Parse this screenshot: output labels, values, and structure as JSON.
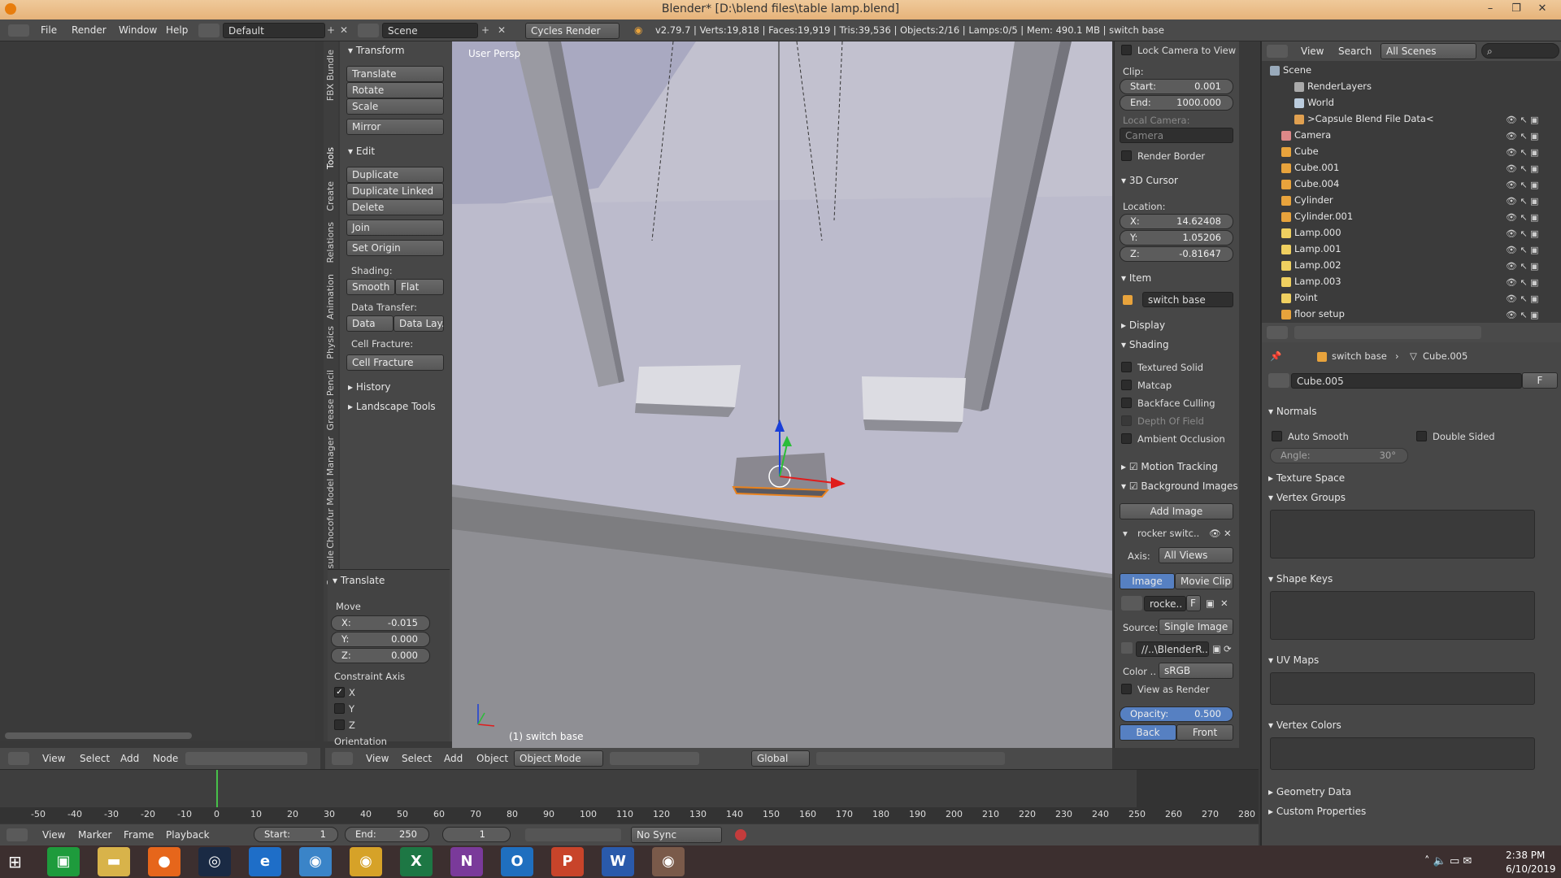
{
  "window": {
    "title": "Blender* [D:\\blend files\\table lamp.blend]",
    "min": "–",
    "max": "❐",
    "close": "✕"
  },
  "menu": {
    "items": [
      "File",
      "Render",
      "Window",
      "Help"
    ],
    "layout": "Default",
    "scene": "Scene",
    "engine": "Cycles Render",
    "stats": "v2.79.7 | Verts:19,818 | Faces:19,919 | Tris:39,536 | Objects:2/16 | Lamps:0/5 | Mem: 490.1 MB | switch base"
  },
  "toolshelf": {
    "tabs": [
      "FBX Bundle",
      "Tools",
      "Create",
      "Relations",
      "Animation",
      "Physics",
      "Grease Pencil",
      "Chocofur Model Manager",
      "Capsule"
    ],
    "transform": {
      "title": "Transform",
      "buttons": [
        "Translate",
        "Rotate",
        "Scale",
        "Mirror"
      ]
    },
    "edit": {
      "title": "Edit",
      "buttons": [
        "Duplicate",
        "Duplicate Linked",
        "Delete",
        "Join"
      ],
      "set_origin": "Set Origin",
      "shading_label": "Shading:",
      "smooth": "Smooth",
      "flat": "Flat",
      "data_transfer_label": "Data Transfer:",
      "data": "Data",
      "data_lay": "Data Lay..",
      "cell_fracture_label": "Cell Fracture:",
      "cell_fracture": "Cell Fracture"
    },
    "history": "History",
    "landscape": "Landscape Tools",
    "operator": {
      "title": "Translate",
      "move": "Move",
      "x": "X:",
      "xv": "-0.015",
      "y": "Y:",
      "yv": "0.000",
      "z": "Z:",
      "zv": "0.000",
      "constraint": "Constraint Axis",
      "cx": "X",
      "cy": "Y",
      "cz": "Z",
      "orientation": "Orientation"
    }
  },
  "viewport": {
    "label": "User Persp",
    "object_label": "(1) switch base",
    "menu": [
      "View",
      "Select",
      "Add",
      "Object"
    ],
    "mode": "Object Mode",
    "orientation": "Global"
  },
  "nodeeditor": {
    "menu": [
      "View",
      "Select",
      "Add",
      "Node"
    ]
  },
  "props": {
    "lock_camera": "Lock Camera to View",
    "clip": "Clip:",
    "start_k": "Start:",
    "start_v": "0.001",
    "end_k": "End:",
    "end_v": "1000.000",
    "local_camera": "Local Camera:",
    "camera": "Camera",
    "render_border": "Render Border",
    "cursor_title": "3D Cursor",
    "location": "Location:",
    "cx": "X:",
    "cxv": "14.62408",
    "cy": "Y:",
    "cyv": "1.05206",
    "cz": "Z:",
    "czv": "-0.81647",
    "item_title": "Item",
    "item_name": "switch base",
    "display": "Display",
    "shading": "Shading",
    "textured_solid": "Textured Solid",
    "matcap": "Matcap",
    "backface": "Backface Culling",
    "dof": "Depth Of Field",
    "ao": "Ambient Occlusion",
    "motion_tracking": "Motion Tracking",
    "bg_images": "Background Images",
    "add_image": "Add Image",
    "bg_item": "rocker switc..",
    "axis_k": "Axis:",
    "axis_v": "All Views",
    "image": "Image",
    "movie_clip": "Movie Clip",
    "img_name": "rocke..",
    "img_f": "F",
    "source_k": "Source:",
    "source_v": "Single Image",
    "path": "//..\\BlenderR..",
    "color_k": "Color ..",
    "color_v": "sRGB",
    "view_as_render": "View as Render",
    "opacity_k": "Opacity:",
    "opacity_v": "0.500",
    "back": "Back",
    "front": "Front"
  },
  "outliner": {
    "menu": [
      "View",
      "Search"
    ],
    "filter": "All Scenes",
    "rows": [
      {
        "name": "Scene"
      },
      {
        "name": "RenderLayers"
      },
      {
        "name": "World"
      },
      {
        "name": ">Capsule Blend File Data<"
      },
      {
        "name": "Camera"
      },
      {
        "name": "Cube"
      },
      {
        "name": "Cube.001"
      },
      {
        "name": "Cube.004"
      },
      {
        "name": "Cylinder"
      },
      {
        "name": "Cylinder.001"
      },
      {
        "name": "Lamp.000"
      },
      {
        "name": "Lamp.001"
      },
      {
        "name": "Lamp.002"
      },
      {
        "name": "Lamp.003"
      },
      {
        "name": "Point"
      },
      {
        "name": "floor setup"
      }
    ]
  },
  "properties": {
    "crumb_obj": "switch base",
    "crumb_mesh": "Cube.005",
    "mesh_name": "Cube.005",
    "mesh_f": "F",
    "normals": "Normals",
    "auto_smooth": "Auto Smooth",
    "double_sided": "Double Sided",
    "angle_k": "Angle:",
    "angle_v": "30°",
    "texture_space": "Texture Space",
    "vertex_groups": "Vertex Groups",
    "shape_keys": "Shape Keys",
    "uv_maps": "UV Maps",
    "vertex_colors": "Vertex Colors",
    "geometry_data": "Geometry Data",
    "custom_props": "Custom Properties"
  },
  "timeline": {
    "menu": [
      "View",
      "Marker",
      "Frame",
      "Playback"
    ],
    "start_k": "Start:",
    "start_v": "1",
    "end_k": "End:",
    "end_v": "250",
    "frame": "1",
    "sync": "No Sync",
    "ticks": [
      "-50",
      "-40",
      "-30",
      "-20",
      "-10",
      "0",
      "10",
      "20",
      "30",
      "40",
      "50",
      "60",
      "70",
      "80",
      "90",
      "100",
      "110",
      "120",
      "130",
      "140",
      "150",
      "160",
      "170",
      "180",
      "190",
      "200",
      "210",
      "220",
      "230",
      "240",
      "250",
      "260",
      "270",
      "280"
    ]
  },
  "taskbar": {
    "time": "2:38 PM",
    "date": "6/10/2019"
  }
}
